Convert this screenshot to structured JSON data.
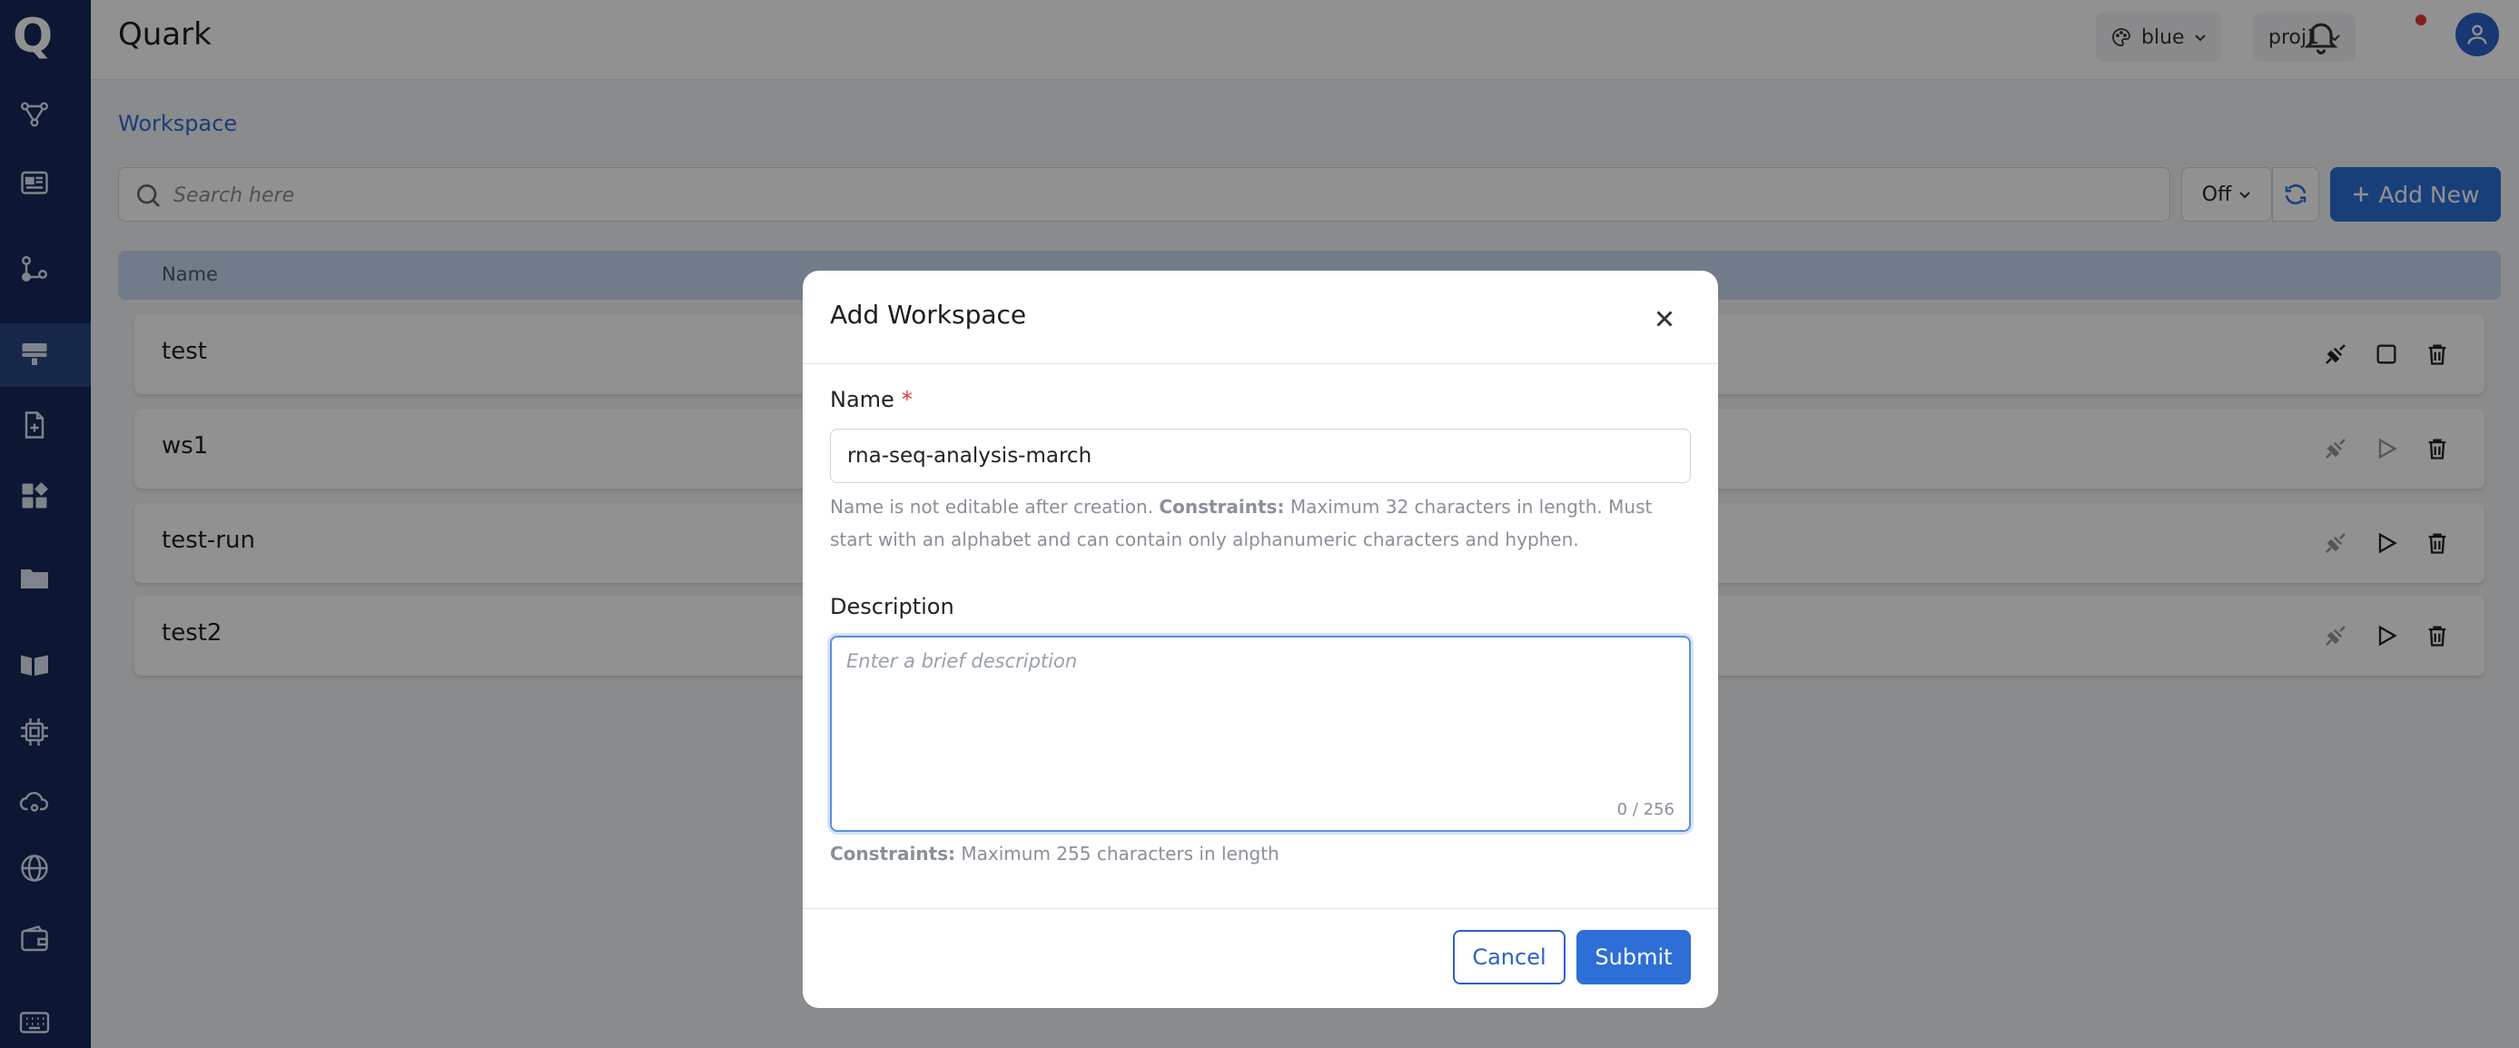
{
  "app": {
    "logo": "Q",
    "title": "Quark"
  },
  "header": {
    "theme": {
      "icon": "palette-icon",
      "value": "blue"
    },
    "project": {
      "value": "proj1"
    },
    "notifications": {
      "icon": "bell-icon",
      "has_unread": true
    },
    "user": {
      "icon": "user-icon"
    }
  },
  "sidebar": {
    "items": [
      {
        "icon": "pipeline-icon"
      },
      {
        "icon": "dashboard-icon"
      },
      {
        "icon": "workflow-icon"
      },
      {
        "icon": "workspace-icon",
        "active": true
      },
      {
        "icon": "file-add-icon"
      },
      {
        "icon": "apps-icon"
      },
      {
        "icon": "folder-icon"
      },
      {
        "icon": "book-icon"
      },
      {
        "icon": "chip-icon"
      },
      {
        "icon": "cloud-settings-icon"
      },
      {
        "icon": "globe-icon"
      },
      {
        "icon": "wallet-icon"
      },
      {
        "icon": "keyboard-icon"
      }
    ]
  },
  "main": {
    "breadcrumb": "Workspace",
    "search": {
      "placeholder": "Search here"
    },
    "toggle": {
      "value": "Off"
    },
    "add_button": "Add New",
    "table": {
      "columns": [
        "Name"
      ],
      "rows": [
        {
          "name": "test",
          "status": "running"
        },
        {
          "name": "ws1",
          "status": "starting"
        },
        {
          "name": "test-run",
          "status": "stopped"
        },
        {
          "name": "test2",
          "status": "stopped"
        }
      ]
    }
  },
  "modal": {
    "title": "Add Workspace",
    "name_label": "Name",
    "required_marker": "*",
    "name_value": "rna-seq-analysis-march",
    "name_help_prefix": "Name is not editable after creation.",
    "constraints_label": "Constraints:",
    "name_help_suffix": "Maximum 32 characters in length. Must start with an alphabet and can contain only alphanumeric characters and hyphen.",
    "description_label": "Description",
    "description_placeholder": "Enter a brief description",
    "description_value": "",
    "description_counter": "0 / 256",
    "description_help": "Maximum 255 characters in length",
    "cancel_label": "Cancel",
    "submit_label": "Submit"
  },
  "colors": {
    "primary": "#2d6fd6",
    "sidebar": "#15295a",
    "table_header": "#c9d8f2",
    "required": "#e53935"
  }
}
